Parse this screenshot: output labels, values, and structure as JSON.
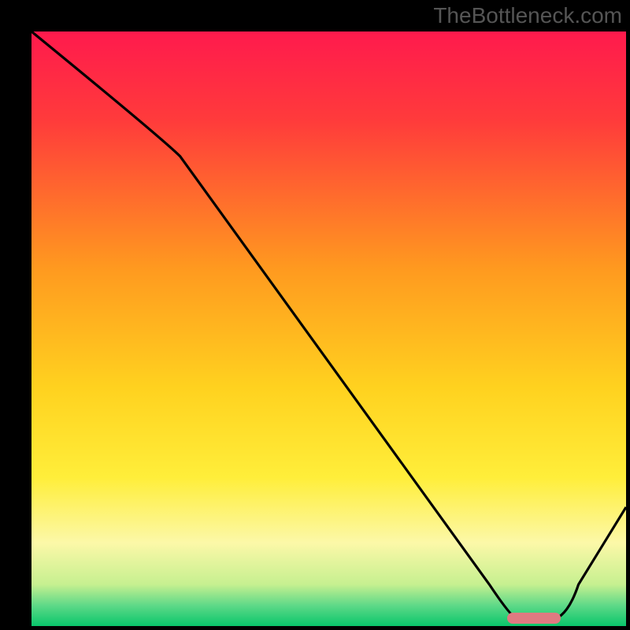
{
  "watermark": "TheBottleneck.com",
  "chart_data": {
    "type": "line",
    "title": "",
    "xlabel": "",
    "ylabel": "",
    "xlim": [
      0,
      100
    ],
    "ylim": [
      0,
      100
    ],
    "x": [
      0,
      25,
      81,
      88,
      100
    ],
    "values": [
      100,
      79,
      1,
      1,
      20
    ],
    "gradient_stops": [
      {
        "pos": 0.0,
        "color": "#ff1a4d"
      },
      {
        "pos": 0.15,
        "color": "#ff3b3b"
      },
      {
        "pos": 0.4,
        "color": "#ff9a1f"
      },
      {
        "pos": 0.6,
        "color": "#ffd21f"
      },
      {
        "pos": 0.75,
        "color": "#ffee3a"
      },
      {
        "pos": 0.86,
        "color": "#fcf8a8"
      },
      {
        "pos": 0.93,
        "color": "#c6f090"
      },
      {
        "pos": 0.965,
        "color": "#5fd988"
      },
      {
        "pos": 1.0,
        "color": "#09c66b"
      }
    ],
    "marker": {
      "x_start": 80,
      "x_end": 89,
      "y": 1.3,
      "color": "#e07a81"
    },
    "line_color": "#000000",
    "line_width": 3.2
  }
}
